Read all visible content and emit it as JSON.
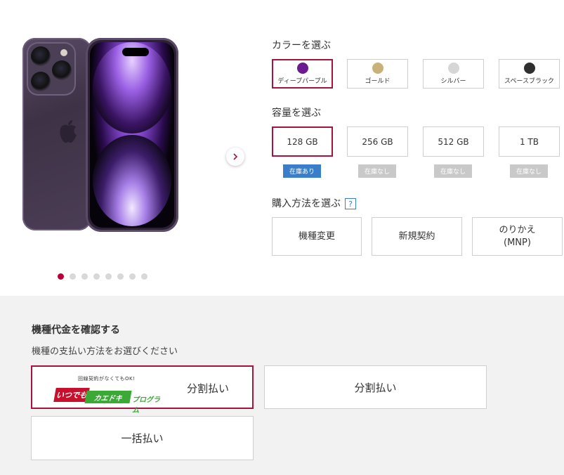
{
  "product": {
    "gallery_total": 8,
    "gallery_active": 1
  },
  "color": {
    "label": "カラーを選ぶ",
    "options": [
      {
        "label": "ディープパープル",
        "swatch": "#6a1b8f",
        "selected": true
      },
      {
        "label": "ゴールド",
        "swatch": "#c9b27a",
        "selected": false
      },
      {
        "label": "シルバー",
        "swatch": "#d6d6d6",
        "selected": false
      },
      {
        "label": "スペースブラック",
        "swatch": "#2f2f2f",
        "selected": false
      }
    ]
  },
  "capacity": {
    "label": "容量を選ぶ",
    "options": [
      {
        "label": "128 GB",
        "stock": "在庫あり",
        "in_stock": true,
        "selected": true
      },
      {
        "label": "256 GB",
        "stock": "在庫なし",
        "in_stock": false,
        "selected": false
      },
      {
        "label": "512 GB",
        "stock": "在庫なし",
        "in_stock": false,
        "selected": false
      },
      {
        "label": "1 TB",
        "stock": "在庫なし",
        "in_stock": false,
        "selected": false
      }
    ]
  },
  "purchase": {
    "label": "購入方法を選ぶ",
    "help": "?",
    "options": [
      "機種変更",
      "新規契約",
      "のりかえ\n(MNP)"
    ]
  },
  "payment": {
    "title": "機種代金を確認する",
    "subtitle": "機種の支払い方法をお選びください",
    "promo": {
      "caption": "回線契約がなくてもOK!",
      "brand_red": "いつでも",
      "brand_green": "カエドキ",
      "brand_program": "プログラム"
    },
    "options": [
      "分割払い",
      "分割払い",
      "一括払い"
    ]
  },
  "colors": {
    "accent": "#a8123e",
    "in_stock": "#3a7ec9",
    "out_stock": "#c9c9c9",
    "section_bg": "#f2f2f2"
  }
}
